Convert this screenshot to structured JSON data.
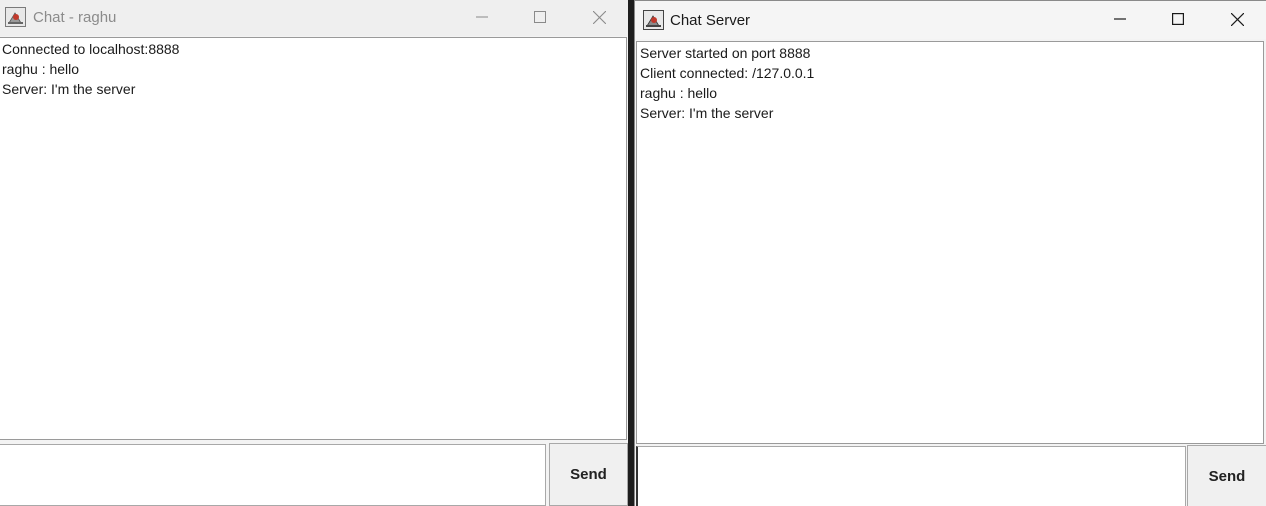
{
  "client": {
    "title": "Chat - raghu",
    "messages": [
      "Connected to localhost:8888",
      "raghu : hello",
      "Server: I'm the server"
    ],
    "input_value": "",
    "send_label": "Send"
  },
  "server": {
    "title": "Chat Server",
    "messages": [
      "Server started on port 8888",
      "Client connected: /127.0.0.1",
      "raghu : hello",
      "Server: I'm the server"
    ],
    "input_value": "",
    "send_label": "Send"
  },
  "icons": {
    "app": "java-coffee-icon",
    "minimize": "minimize-icon",
    "maximize": "maximize-icon",
    "close": "close-icon"
  }
}
